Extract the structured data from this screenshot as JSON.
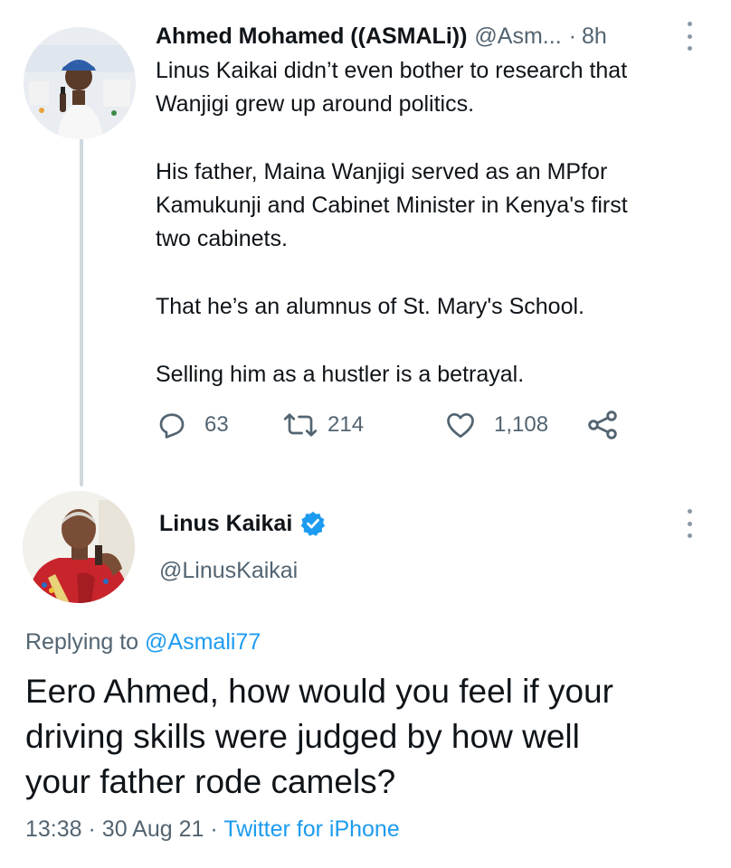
{
  "tweet1": {
    "display_name": "Ahmed Mohamed ((ASMALi))",
    "handle": "@Asm...",
    "separator": "·",
    "time": "8h",
    "lines": [
      "Linus Kaikai didn’t even bother to research that",
      "Wanjigi grew up around politics.",
      "His father, Maina Wanjigi served as an MPfor",
      "Kamukunji and Cabinet Minister in Kenya's first",
      "two cabinets.",
      "That he’s an alumnus of St. Mary's School.",
      "Selling him as a hustler is a betrayal."
    ],
    "replies": "63",
    "retweets": "214",
    "likes": "1,108"
  },
  "tweet2": {
    "display_name": "Linus Kaikai",
    "handle": "@LinusKaikai",
    "replying_prefix": "Replying to",
    "replying_handle": "@Asmali77",
    "lines": [
      "Eero Ahmed, how would you feel if your",
      "driving skills were judged by how well",
      "your father rode camels?"
    ],
    "time": "13:38",
    "date": "30 Aug 21",
    "source": "Twitter for iPhone",
    "meta_separator": "·"
  },
  "colors": {
    "text": "#0f1419",
    "muted": "#536471",
    "accent": "#1d9bf0",
    "thread_line": "#cfd9de"
  },
  "icons": [
    "reply-icon",
    "retweet-icon",
    "like-icon",
    "share-icon",
    "verified-badge-icon",
    "more-options-icon"
  ]
}
